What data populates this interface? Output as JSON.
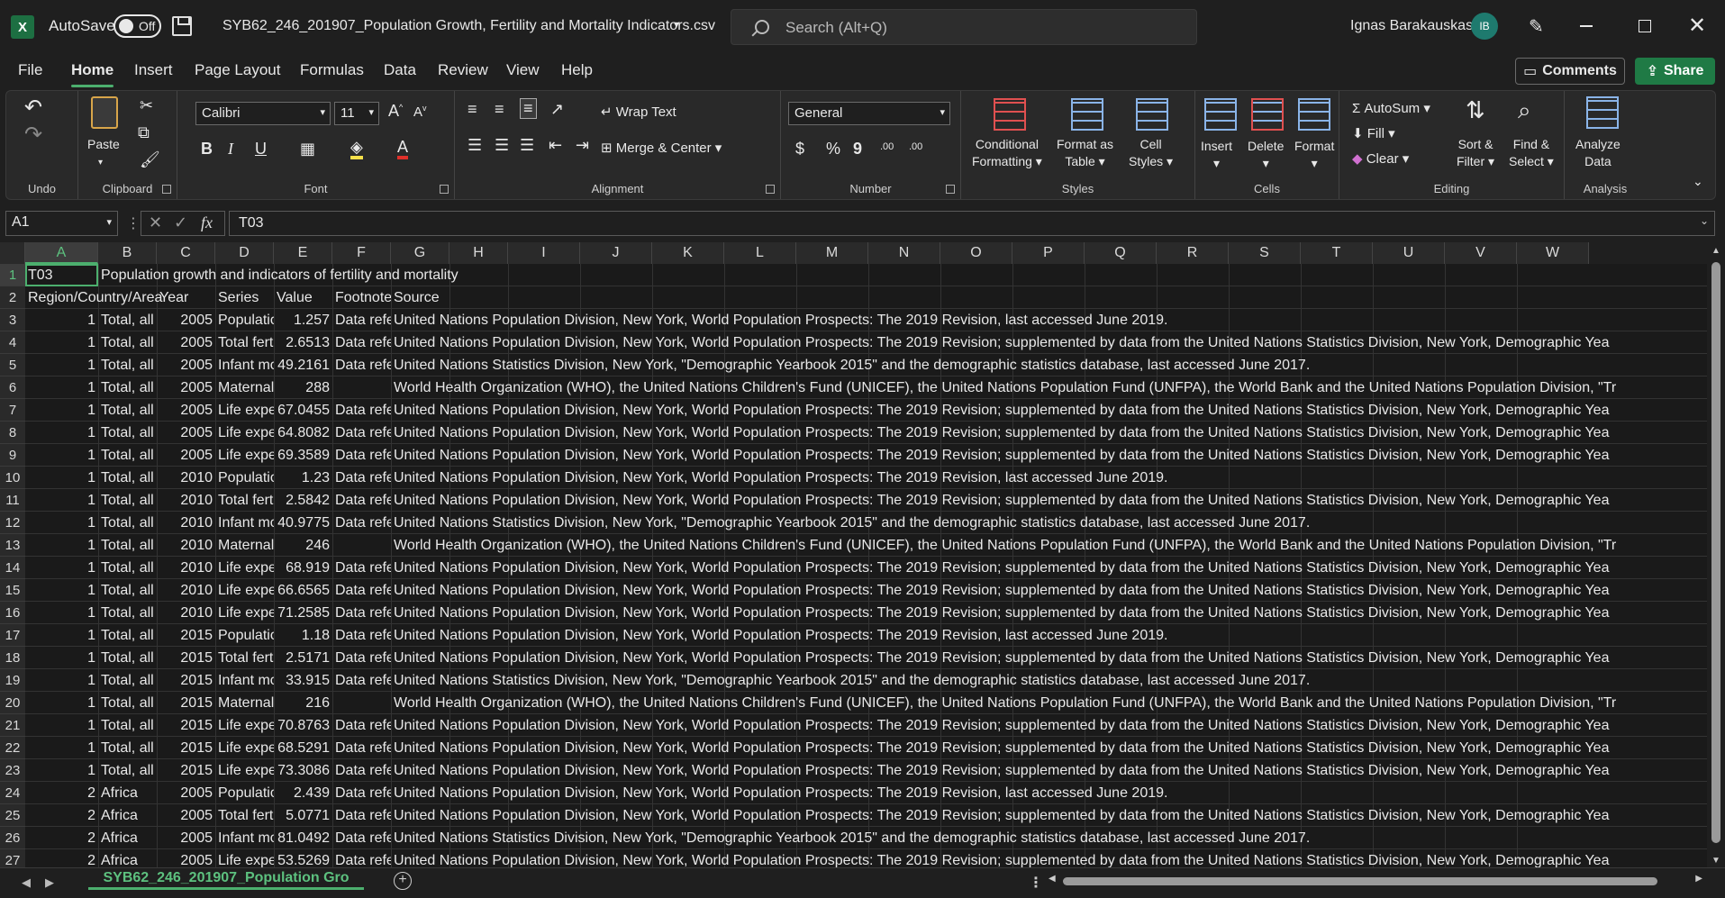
{
  "titlebar": {
    "app_logo": "X",
    "autosave_label": "AutoSave",
    "autosave_state": "Off",
    "doc_title": "SYB62_246_201907_Population Growth, Fertility and Mortality Indicators.csv",
    "search_placeholder": "Search (Alt+Q)",
    "user_name": "Ignas Barakauskas",
    "user_initials": "IB"
  },
  "menu": {
    "items": [
      "File",
      "Home",
      "Insert",
      "Page Layout",
      "Formulas",
      "Data",
      "Review",
      "View",
      "Help"
    ],
    "comments_label": "Comments",
    "share_label": "Share"
  },
  "ribbon": {
    "undo_label": "Undo",
    "clipboard": {
      "paste_label": "Paste",
      "group_label": "Clipboard"
    },
    "font": {
      "name": "Calibri",
      "size": "11",
      "group_label": "Font",
      "bold": "B",
      "italic": "I",
      "underline": "U"
    },
    "alignment": {
      "wrap_text": "Wrap Text",
      "merge_center": "Merge & Center",
      "group_label": "Alignment"
    },
    "number": {
      "format": "General",
      "group_label": "Number",
      "currency": "$",
      "percent": "%",
      "comma": "9",
      "inc_decimal": ".00",
      "dec_decimal": ".00"
    },
    "styles": {
      "conditional_1": "Conditional",
      "conditional_2": "Formatting",
      "format_table_1": "Format as",
      "format_table_2": "Table",
      "cell_styles_1": "Cell",
      "cell_styles_2": "Styles",
      "group_label": "Styles"
    },
    "cells": {
      "insert": "Insert",
      "delete": "Delete",
      "format": "Format",
      "group_label": "Cells"
    },
    "editing": {
      "autosum": "AutoSum",
      "fill": "Fill",
      "clear": "Clear",
      "sort_1": "Sort &",
      "sort_2": "Filter",
      "find_1": "Find &",
      "find_2": "Select",
      "group_label": "Editing"
    },
    "analysis": {
      "analyze_1": "Analyze",
      "analyze_2": "Data",
      "group_label": "Analysis"
    }
  },
  "formula_bar": {
    "name_box": "A1",
    "fx": "fx",
    "formula": "T03"
  },
  "grid": {
    "columns": [
      "A",
      "B",
      "C",
      "D",
      "E",
      "F",
      "G",
      "H",
      "I",
      "J",
      "K",
      "L",
      "M",
      "N",
      "O",
      "P",
      "Q",
      "R",
      "S",
      "T",
      "U",
      "V",
      "W"
    ],
    "rows": [
      [
        "1",
        "T03",
        "Population growth and indicators of fertility and mortality",
        "",
        "",
        "",
        "",
        ""
      ],
      [
        "2",
        "Region/Country/Area",
        "Year",
        "",
        "Series",
        "Value",
        "Footnotes",
        "Source"
      ],
      [
        "3",
        "1",
        "Total, all c",
        "2005",
        "Populatior",
        "1.257",
        "Data refer",
        "United Nations Population Division, New York, World Population Prospects: The 2019 Revision, last accessed June 2019."
      ],
      [
        "4",
        "1",
        "Total, all c",
        "2005",
        "Total fertil",
        "2.6513",
        "Data refer",
        "United Nations Population Division, New York, World Population Prospects: The 2019 Revision; supplemented by data from the United Nations Statistics Division, New York, Demographic Yea"
      ],
      [
        "5",
        "1",
        "Total, all c",
        "2005",
        "Infant mor",
        "49.2161",
        "Data refer",
        "United Nations Statistics Division, New York, \"Demographic Yearbook 2015\" and the demographic statistics database, last accessed June 2017."
      ],
      [
        "6",
        "1",
        "Total, all c",
        "2005",
        "Maternal r",
        "288",
        "",
        "World Health Organization (WHO), the United Nations Children's Fund (UNICEF), the United Nations Population Fund (UNFPA), the World Bank and the United Nations Population Division, \"Tr"
      ],
      [
        "7",
        "1",
        "Total, all c",
        "2005",
        "Life expect",
        "67.0455",
        "Data refer",
        "United Nations Population Division, New York, World Population Prospects: The 2019 Revision; supplemented by data from the United Nations Statistics Division, New York, Demographic Yea"
      ],
      [
        "8",
        "1",
        "Total, all c",
        "2005",
        "Life expect",
        "64.8082",
        "Data refer",
        "United Nations Population Division, New York, World Population Prospects: The 2019 Revision; supplemented by data from the United Nations Statistics Division, New York, Demographic Yea"
      ],
      [
        "9",
        "1",
        "Total, all c",
        "2005",
        "Life expect",
        "69.3589",
        "Data refer",
        "United Nations Population Division, New York, World Population Prospects: The 2019 Revision; supplemented by data from the United Nations Statistics Division, New York, Demographic Yea"
      ],
      [
        "10",
        "1",
        "Total, all c",
        "2010",
        "Populatior",
        "1.23",
        "Data refer",
        "United Nations Population Division, New York, World Population Prospects: The 2019 Revision, last accessed June 2019."
      ],
      [
        "11",
        "1",
        "Total, all c",
        "2010",
        "Total fertil",
        "2.5842",
        "Data refer",
        "United Nations Population Division, New York, World Population Prospects: The 2019 Revision; supplemented by data from the United Nations Statistics Division, New York, Demographic Yea"
      ],
      [
        "12",
        "1",
        "Total, all c",
        "2010",
        "Infant mor",
        "40.9775",
        "Data refer",
        "United Nations Statistics Division, New York, \"Demographic Yearbook 2015\" and the demographic statistics database, last accessed June 2017."
      ],
      [
        "13",
        "1",
        "Total, all c",
        "2010",
        "Maternal r",
        "246",
        "",
        "World Health Organization (WHO), the United Nations Children's Fund (UNICEF), the United Nations Population Fund (UNFPA), the World Bank and the United Nations Population Division, \"Tr"
      ],
      [
        "14",
        "1",
        "Total, all c",
        "2010",
        "Life expect",
        "68.919",
        "Data refer",
        "United Nations Population Division, New York, World Population Prospects: The 2019 Revision; supplemented by data from the United Nations Statistics Division, New York, Demographic Yea"
      ],
      [
        "15",
        "1",
        "Total, all c",
        "2010",
        "Life expect",
        "66.6565",
        "Data refer",
        "United Nations Population Division, New York, World Population Prospects: The 2019 Revision; supplemented by data from the United Nations Statistics Division, New York, Demographic Yea"
      ],
      [
        "16",
        "1",
        "Total, all c",
        "2010",
        "Life expect",
        "71.2585",
        "Data refer",
        "United Nations Population Division, New York, World Population Prospects: The 2019 Revision; supplemented by data from the United Nations Statistics Division, New York, Demographic Yea"
      ],
      [
        "17",
        "1",
        "Total, all c",
        "2015",
        "Populatior",
        "1.18",
        "Data refer",
        "United Nations Population Division, New York, World Population Prospects: The 2019 Revision, last accessed June 2019."
      ],
      [
        "18",
        "1",
        "Total, all c",
        "2015",
        "Total fertil",
        "2.5171",
        "Data refer",
        "United Nations Population Division, New York, World Population Prospects: The 2019 Revision; supplemented by data from the United Nations Statistics Division, New York, Demographic Yea"
      ],
      [
        "19",
        "1",
        "Total, all c",
        "2015",
        "Infant mor",
        "33.915",
        "Data refer",
        "United Nations Statistics Division, New York, \"Demographic Yearbook 2015\" and the demographic statistics database, last accessed June 2017."
      ],
      [
        "20",
        "1",
        "Total, all c",
        "2015",
        "Maternal r",
        "216",
        "",
        "World Health Organization (WHO), the United Nations Children's Fund (UNICEF), the United Nations Population Fund (UNFPA), the World Bank and the United Nations Population Division, \"Tr"
      ],
      [
        "21",
        "1",
        "Total, all c",
        "2015",
        "Life expect",
        "70.8763",
        "Data refer",
        "United Nations Population Division, New York, World Population Prospects: The 2019 Revision; supplemented by data from the United Nations Statistics Division, New York, Demographic Yea"
      ],
      [
        "22",
        "1",
        "Total, all c",
        "2015",
        "Life expect",
        "68.5291",
        "Data refer",
        "United Nations Population Division, New York, World Population Prospects: The 2019 Revision; supplemented by data from the United Nations Statistics Division, New York, Demographic Yea"
      ],
      [
        "23",
        "1",
        "Total, all c",
        "2015",
        "Life expect",
        "73.3086",
        "Data refer",
        "United Nations Population Division, New York, World Population Prospects: The 2019 Revision; supplemented by data from the United Nations Statistics Division, New York, Demographic Yea"
      ],
      [
        "24",
        "2",
        "Africa",
        "2005",
        "Populatior",
        "2.439",
        "Data refer",
        "United Nations Population Division, New York, World Population Prospects: The 2019 Revision, last accessed June 2019."
      ],
      [
        "25",
        "2",
        "Africa",
        "2005",
        "Total fertil",
        "5.0771",
        "Data refer",
        "United Nations Population Division, New York, World Population Prospects: The 2019 Revision; supplemented by data from the United Nations Statistics Division, New York, Demographic Yea"
      ],
      [
        "26",
        "2",
        "Africa",
        "2005",
        "Infant mor",
        "81.0492",
        "Data refer",
        "United Nations Statistics Division, New York, \"Demographic Yearbook 2015\" and the demographic statistics database, last accessed June 2017."
      ],
      [
        "27",
        "2",
        "Africa",
        "2005",
        "Life expect",
        "53.5269",
        "Data refer",
        "United Nations Population Division, New York, World Population Prospects: The 2019 Revision; supplemented by data from the United Nations Statistics Division, New York, Demographic Yea"
      ]
    ]
  },
  "sheet_tab": "SYB62_246_201907_Population Gro",
  "colors": {
    "accent": "#4caf6e",
    "share": "#1f7a45",
    "background": "#1f1f1f"
  }
}
